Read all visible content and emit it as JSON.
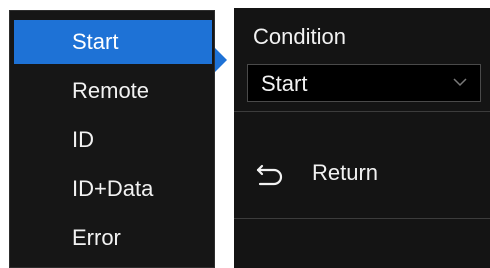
{
  "menu": {
    "items": [
      {
        "label": "Start",
        "selected": true
      },
      {
        "label": "Remote",
        "selected": false
      },
      {
        "label": "ID",
        "selected": false
      },
      {
        "label": "ID+Data",
        "selected": false
      },
      {
        "label": "Error",
        "selected": false
      }
    ]
  },
  "panel": {
    "condition_label": "Condition",
    "condition_value": "Start",
    "return_label": "Return"
  },
  "colors": {
    "accent": "#1e72d6",
    "background": "#141414",
    "text": "#f2f2f2"
  },
  "icons": {
    "dropdown": "chevron-down-icon",
    "return": "return-arrow-icon"
  }
}
